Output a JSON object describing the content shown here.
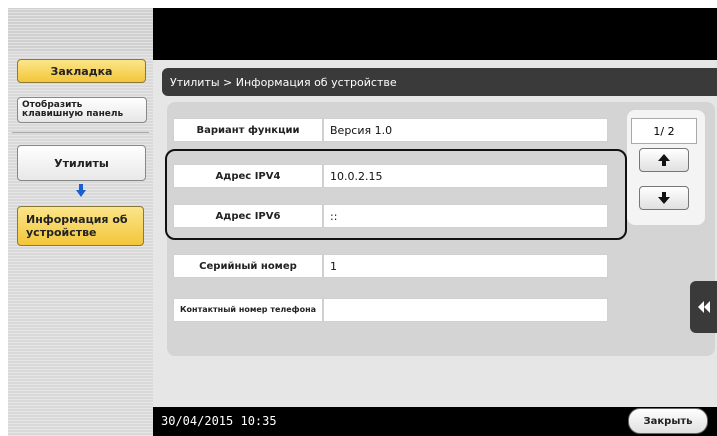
{
  "sidebar": {
    "bookmark_label": "Закладка",
    "keypad_label": "Отобразить клавишную панель",
    "utilities_label": "Утилиты",
    "device_info_label": "Информация об устройстве"
  },
  "header": {
    "breadcrumb": "Утилиты > Информация об устройстве"
  },
  "device_info": {
    "rows": [
      {
        "label": "Вариант функции",
        "value": "Версия 1.0"
      },
      {
        "label": "Адрес IPV4",
        "value": "10.0.2.15"
      },
      {
        "label": "Адрес IPV6",
        "value": "::"
      },
      {
        "label": "Серийный номер",
        "value": "1"
      },
      {
        "label": "Контактный номер телефона",
        "value": ""
      }
    ]
  },
  "pager": {
    "text": "1/ 2"
  },
  "footer": {
    "datetime": "30/04/2015  10:35",
    "close_label": "Закрыть"
  },
  "icons": {
    "up": "arrow-up-icon",
    "down": "arrow-down-icon",
    "flow": "arrow-down-blue-icon",
    "collapse": "double-chevron-left-icon"
  },
  "colors": {
    "highlight_button": "#f3c63a",
    "flow_arrow": "#1a5fd0"
  }
}
